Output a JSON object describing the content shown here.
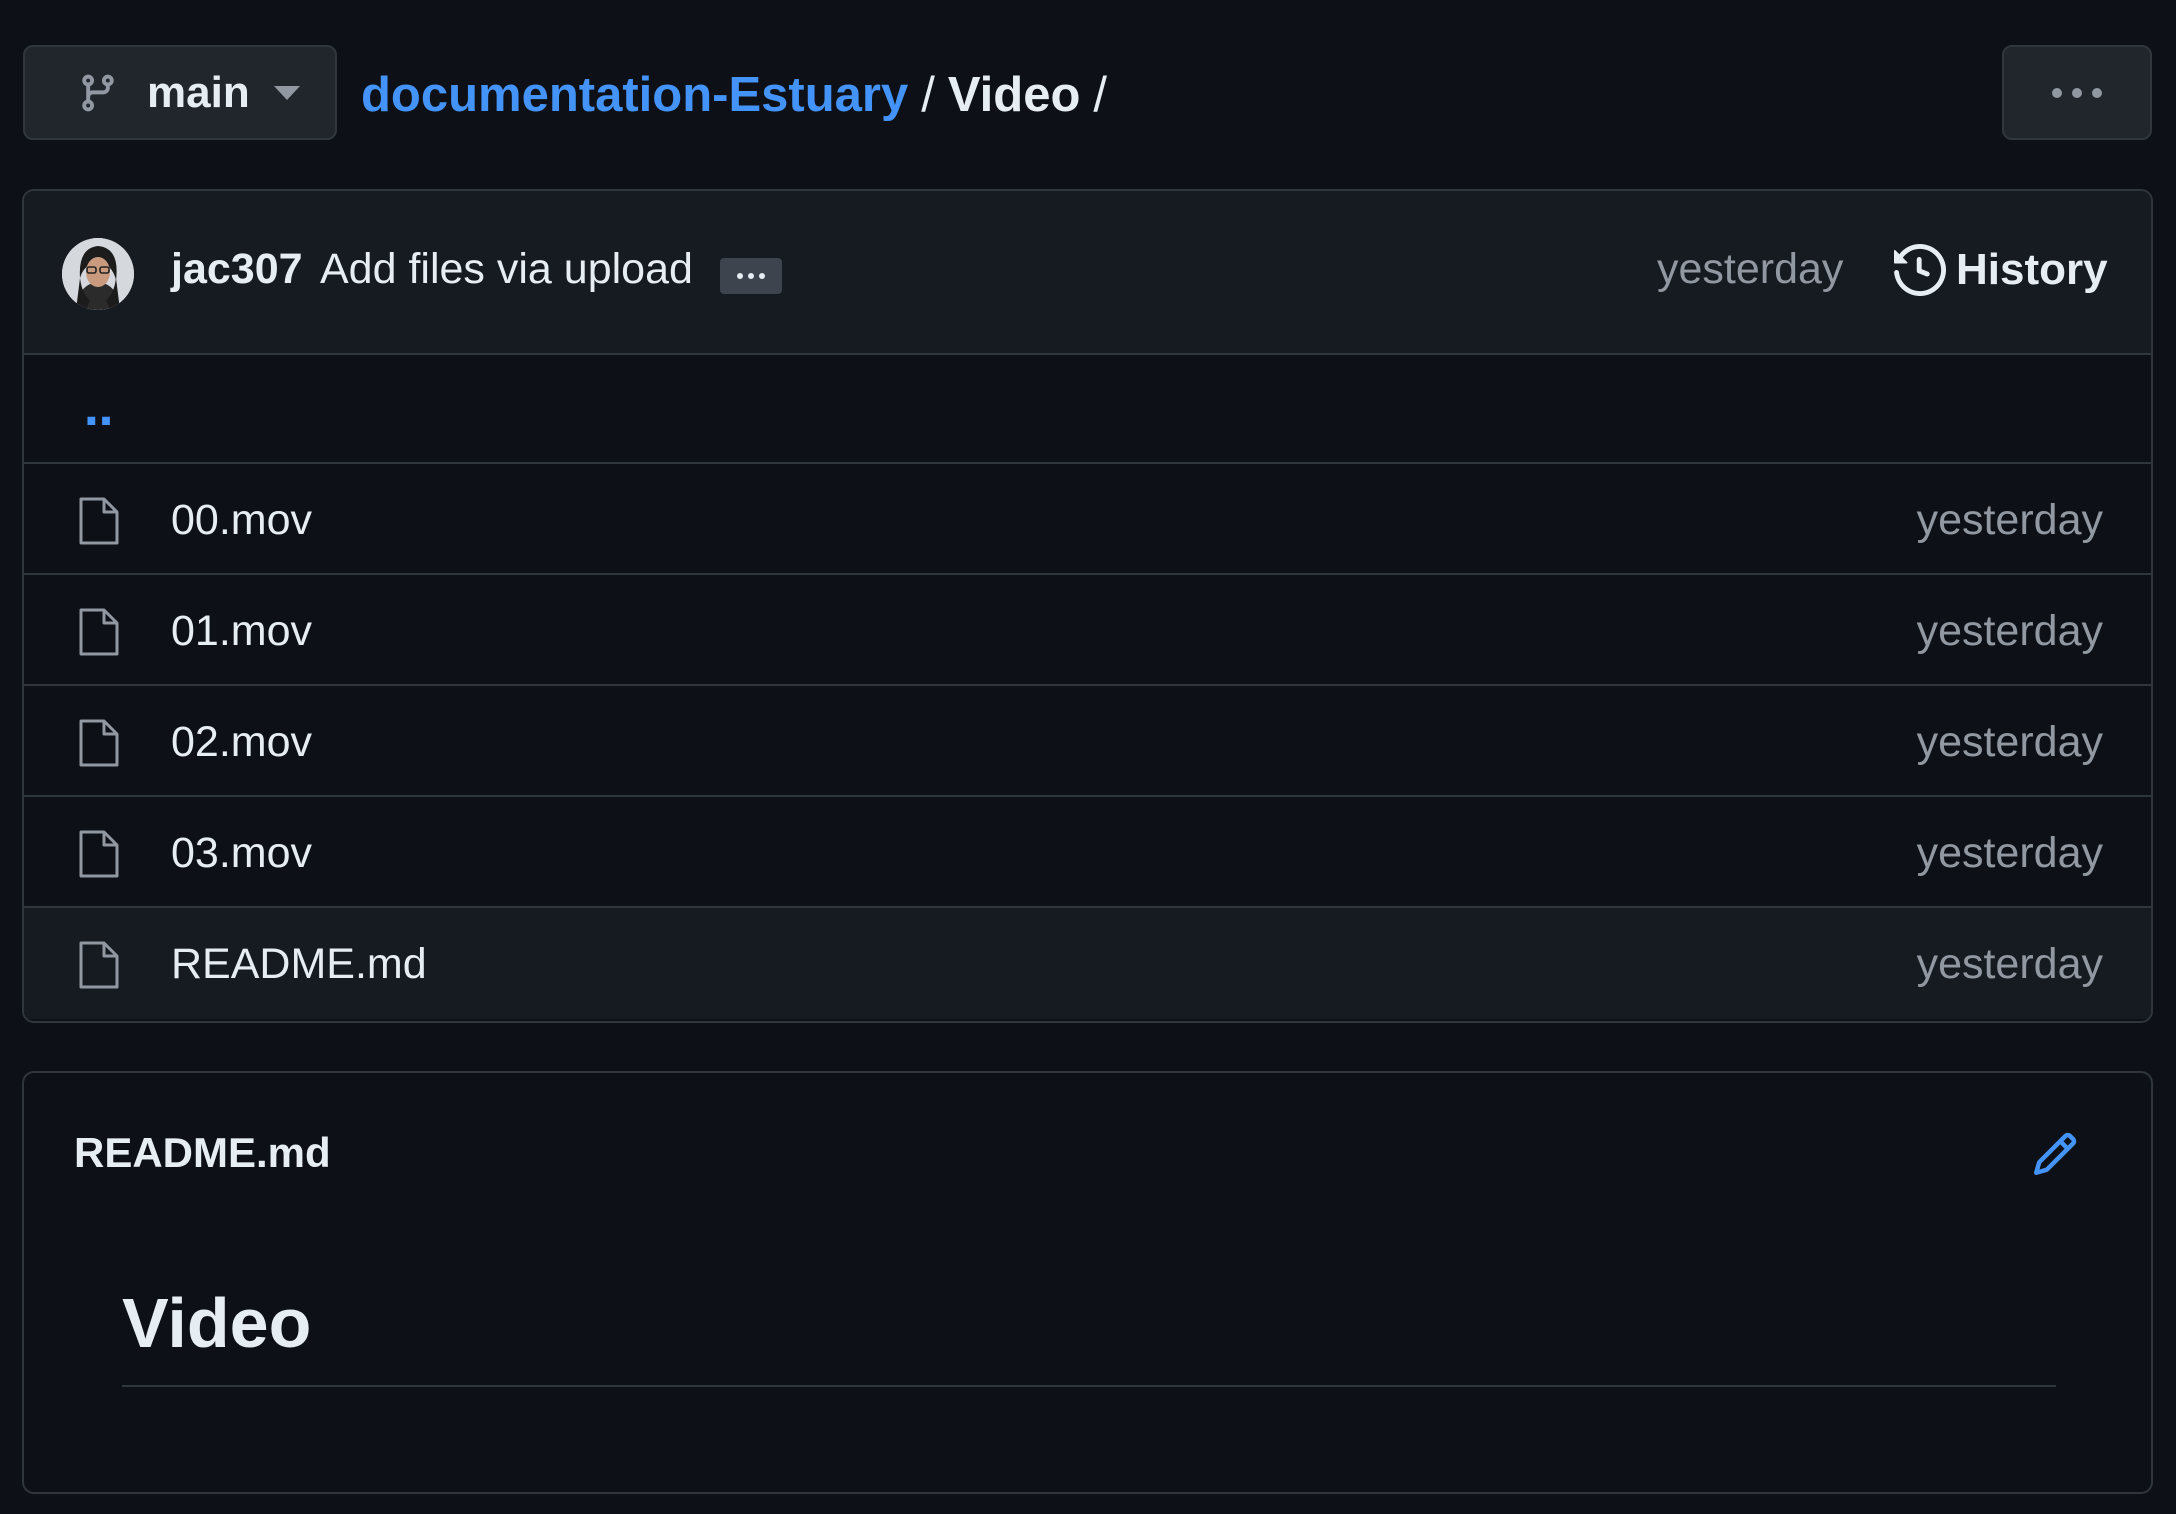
{
  "branch": {
    "name": "main"
  },
  "breadcrumb": {
    "repo": "documentation-Estuary",
    "separator": "/",
    "folder": "Video",
    "trailing_separator": "/"
  },
  "toolbar": {
    "more_icon": "kebab-horizontal-icon"
  },
  "commit": {
    "author": "jac307",
    "message": "Add files via upload",
    "expand_label": "…",
    "time": "yesterday",
    "history_label": "History",
    "history_icon": "history-icon"
  },
  "files": {
    "parent_label": "‥",
    "rows": [
      {
        "name": "00.mov",
        "date": "yesterday",
        "icon": "file-icon"
      },
      {
        "name": "01.mov",
        "date": "yesterday",
        "icon": "file-icon"
      },
      {
        "name": "02.mov",
        "date": "yesterday",
        "icon": "file-icon"
      },
      {
        "name": "03.mov",
        "date": "yesterday",
        "icon": "file-icon"
      },
      {
        "name": "README.md",
        "date": "yesterday",
        "icon": "file-icon"
      }
    ]
  },
  "readme": {
    "title": "README.md",
    "edit_icon": "pencil-icon",
    "heading": "Video"
  },
  "colors": {
    "background": "#0d1117",
    "surface": "#161b22",
    "border": "#30363d",
    "link": "#4493f8",
    "text": "#e6edf3",
    "muted": "#9198a1"
  }
}
